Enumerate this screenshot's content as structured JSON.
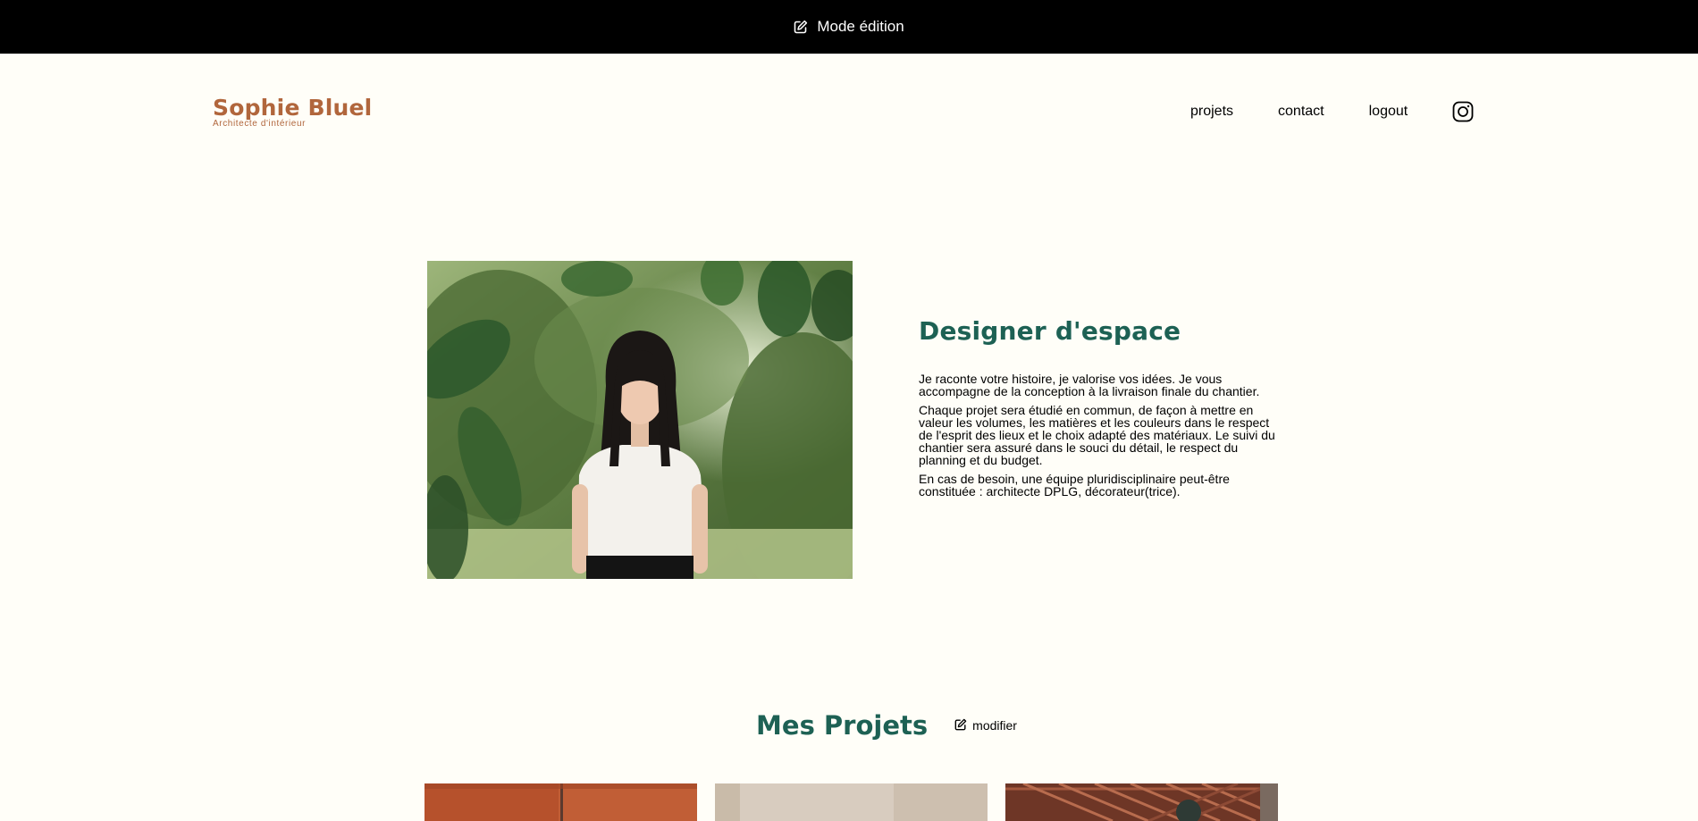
{
  "edit_bar": {
    "icon": "pen-to-square-icon",
    "label": "Mode édition"
  },
  "header": {
    "logo_name": "Sophie Bluel",
    "logo_subtitle": "Architecte d'intérieur",
    "nav": {
      "projets": "projets",
      "contact": "contact",
      "logout": "logout",
      "instagram_icon": "instagram-icon"
    }
  },
  "intro": {
    "photo_alt": "Sophie Bluel",
    "title": "Designer d'espace",
    "paragraphs": [
      "Je raconte votre histoire, je valorise vos idées. Je vous accompagne de la conception à la livraison finale du chantier.",
      "Chaque projet sera étudié en commun, de façon à mettre en valeur les volumes, les matières et les couleurs dans le respect de l'esprit des lieux et le choix adapté des matériaux. Le suivi du chantier sera assuré dans le souci du détail, le respect du planning et du budget.",
      "En cas de besoin, une équipe pluridisciplinaire peut-être constituée : architecte DPLG, décorateur(trice)."
    ]
  },
  "portfolio": {
    "title": "Mes Projets",
    "modify_label": "modifier",
    "modify_icon": "pen-to-square-icon"
  },
  "colors": {
    "accent_brown": "#B1663C",
    "accent_green": "#1D6154",
    "background": "#FFFEF8",
    "edit_bar": "#000000"
  }
}
